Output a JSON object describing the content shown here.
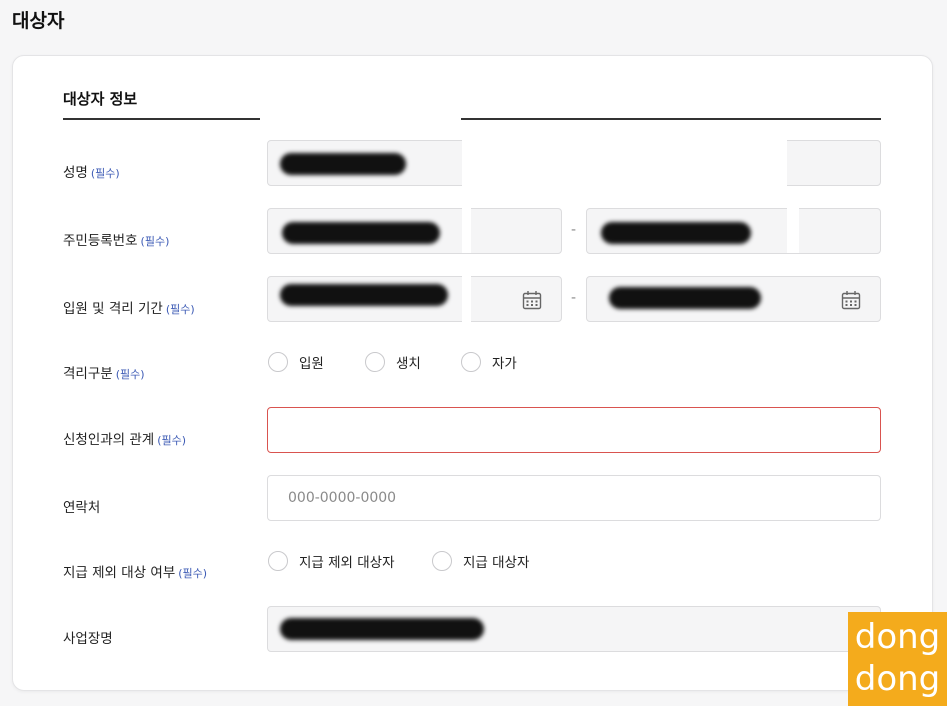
{
  "page": {
    "title": "대상자"
  },
  "section": {
    "title": "대상자 정보"
  },
  "required_tag": "(필수)",
  "fields": {
    "name": {
      "label": "성명"
    },
    "resident_number": {
      "label": "주민등록번호",
      "separator": "-"
    },
    "quarantine_period": {
      "label": "입원 및 격리 기간",
      "separator": "-"
    },
    "quarantine_type": {
      "label": "격리구분",
      "options": [
        "입원",
        "생치",
        "자가"
      ]
    },
    "relationship": {
      "label": "신청인과의 관계",
      "value": ""
    },
    "contact": {
      "label": "연락처",
      "placeholder": "000-0000-0000"
    },
    "payment_exclusion": {
      "label": "지급 제외 대상 여부",
      "options": [
        "지급 제외 대상자",
        "지급 대상자"
      ]
    },
    "business_name": {
      "label": "사업장명"
    }
  },
  "icons": {
    "calendar": "calendar-icon"
  },
  "colors": {
    "required": "#3d5bb5",
    "error_border": "#d9534f",
    "watermark": "#f4ab1c"
  },
  "watermark": {
    "line1": "dong",
    "line2": "dong"
  }
}
